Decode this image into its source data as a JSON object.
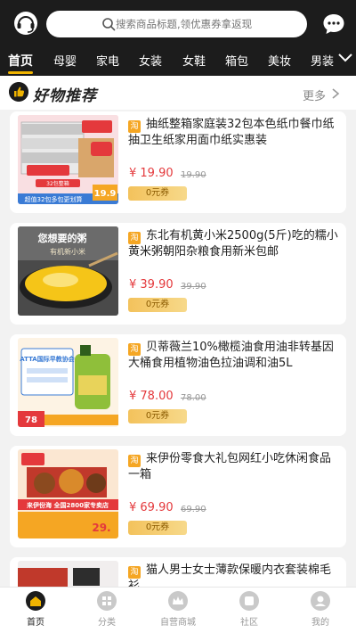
{
  "search": {
    "placeholder": "搜索商品标题,领优惠券拿返现"
  },
  "tabs": [
    {
      "label": "首页",
      "active": true
    },
    {
      "label": "母婴"
    },
    {
      "label": "家电"
    },
    {
      "label": "女装"
    },
    {
      "label": "女鞋"
    },
    {
      "label": "箱包"
    },
    {
      "label": "美妆"
    },
    {
      "label": "男装"
    }
  ],
  "section": {
    "title": "好物推荐",
    "more": "更多"
  },
  "products": [
    {
      "badge": "淘",
      "title": "抽纸整箱家庭装32包本色纸巾餐巾纸抽卫生纸家用面巾纸实惠装",
      "price": "¥ 19.90",
      "original_price": "19.90",
      "coupon": "0元券",
      "image_text": [
        "32包整箱",
        "超值32包多包更划算",
        "19.9"
      ]
    },
    {
      "badge": "淘",
      "title": "东北有机黄小米2500g(5斤)吃的糯小黄米粥朝阳杂粮食用新米包邮",
      "price": "¥ 39.90",
      "original_price": "39.90",
      "coupon": "0元券",
      "image_text": [
        "您想要的粥",
        "有机新小米"
      ]
    },
    {
      "badge": "淘",
      "title": "贝蒂薇兰10%橄榄油食用油非转基因大桶食用植物油色拉油调和油5L",
      "price": "¥ 78.00",
      "original_price": "78.00",
      "coupon": "0元券",
      "image_text": [
        "ATTA国际早教协会",
        "78"
      ]
    },
    {
      "badge": "淘",
      "title": "来伊份零食大礼包网红小吃休闲食品一箱",
      "price": "¥ 69.90",
      "original_price": "69.90",
      "coupon": "0元券",
      "image_text": [
        "来伊份海 全国2800家专卖店",
        "29."
      ]
    },
    {
      "badge": "淘",
      "title": "猫人男士女士薄款保暖内衣套装棉毛衫",
      "price": "",
      "original_price": "",
      "coupon": "",
      "image_text": []
    }
  ],
  "bottom_nav": [
    {
      "label": "首页",
      "icon": "home-icon",
      "active": true
    },
    {
      "label": "分类",
      "icon": "category-icon"
    },
    {
      "label": "自营商城",
      "icon": "crown-icon"
    },
    {
      "label": "社区",
      "icon": "community-icon"
    },
    {
      "label": "我的",
      "icon": "profile-icon"
    }
  ],
  "colors": {
    "header_bg": "#1c1c1c",
    "accent": "#f0b400",
    "price": "#e4393c",
    "coupon_bg": "#f3c25c"
  }
}
